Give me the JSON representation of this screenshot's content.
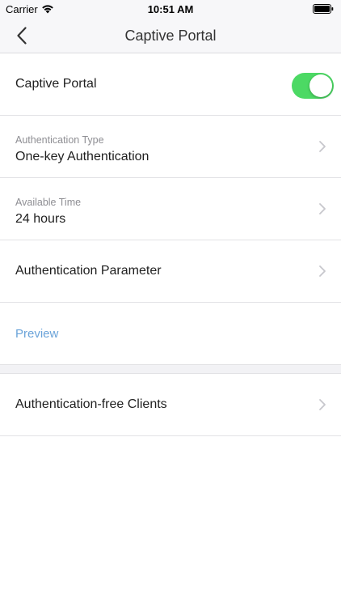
{
  "status_bar": {
    "carrier": "Carrier",
    "time": "10:51 AM",
    "wifi_icon": "wifi-icon",
    "battery_icon": "battery-full-icon"
  },
  "nav": {
    "title": "Captive Portal",
    "back_icon": "chevron-left-icon"
  },
  "rows": {
    "captive_portal": {
      "label": "Captive Portal",
      "toggle_on": true,
      "toggle_color": "#4cd964"
    },
    "authentication_type": {
      "label": "Authentication Type",
      "value": "One-key Authentication"
    },
    "available_time": {
      "label": "Available Time",
      "value": "24 hours"
    },
    "authentication_parameter": {
      "label": "Authentication Parameter"
    },
    "preview": {
      "label": "Preview",
      "color": "#6aa3d9"
    },
    "authentication_free_clients": {
      "label": "Authentication-free Clients"
    }
  },
  "chevron_icon": "chevron-right-icon"
}
